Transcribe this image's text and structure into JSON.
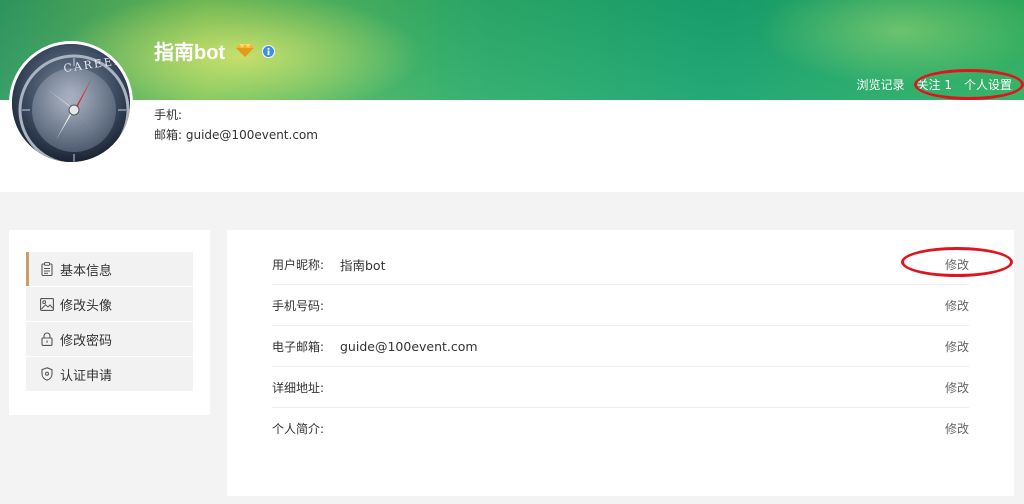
{
  "header": {
    "user_name": "指南bot",
    "links": {
      "history": "浏览记录",
      "follow": "关注 1",
      "settings": "个人设置"
    }
  },
  "profile": {
    "phone_label": "手机:",
    "phone_value": "",
    "email_label": "邮箱:",
    "email_value": "guide@100event.com",
    "avatar_text": "CAREER"
  },
  "sidebar": {
    "items": [
      {
        "label": "基本信息",
        "icon": "clipboard-icon",
        "active": true
      },
      {
        "label": "修改头像",
        "icon": "image-icon",
        "active": false
      },
      {
        "label": "修改密码",
        "icon": "lock-icon",
        "active": false
      },
      {
        "label": "认证申请",
        "icon": "shield-icon",
        "active": false
      }
    ]
  },
  "info": {
    "edit_label": "修改",
    "rows": [
      {
        "label": "用户昵称:",
        "value": "指南bot"
      },
      {
        "label": "手机号码:",
        "value": ""
      },
      {
        "label": "电子邮箱:",
        "value": "guide@100event.com"
      },
      {
        "label": "详细地址:",
        "value": ""
      },
      {
        "label": "个人简介:",
        "value": ""
      }
    ]
  },
  "colors": {
    "accent": "#c8a064",
    "annotation": "#e0141e",
    "banner": "#2fae6a"
  }
}
